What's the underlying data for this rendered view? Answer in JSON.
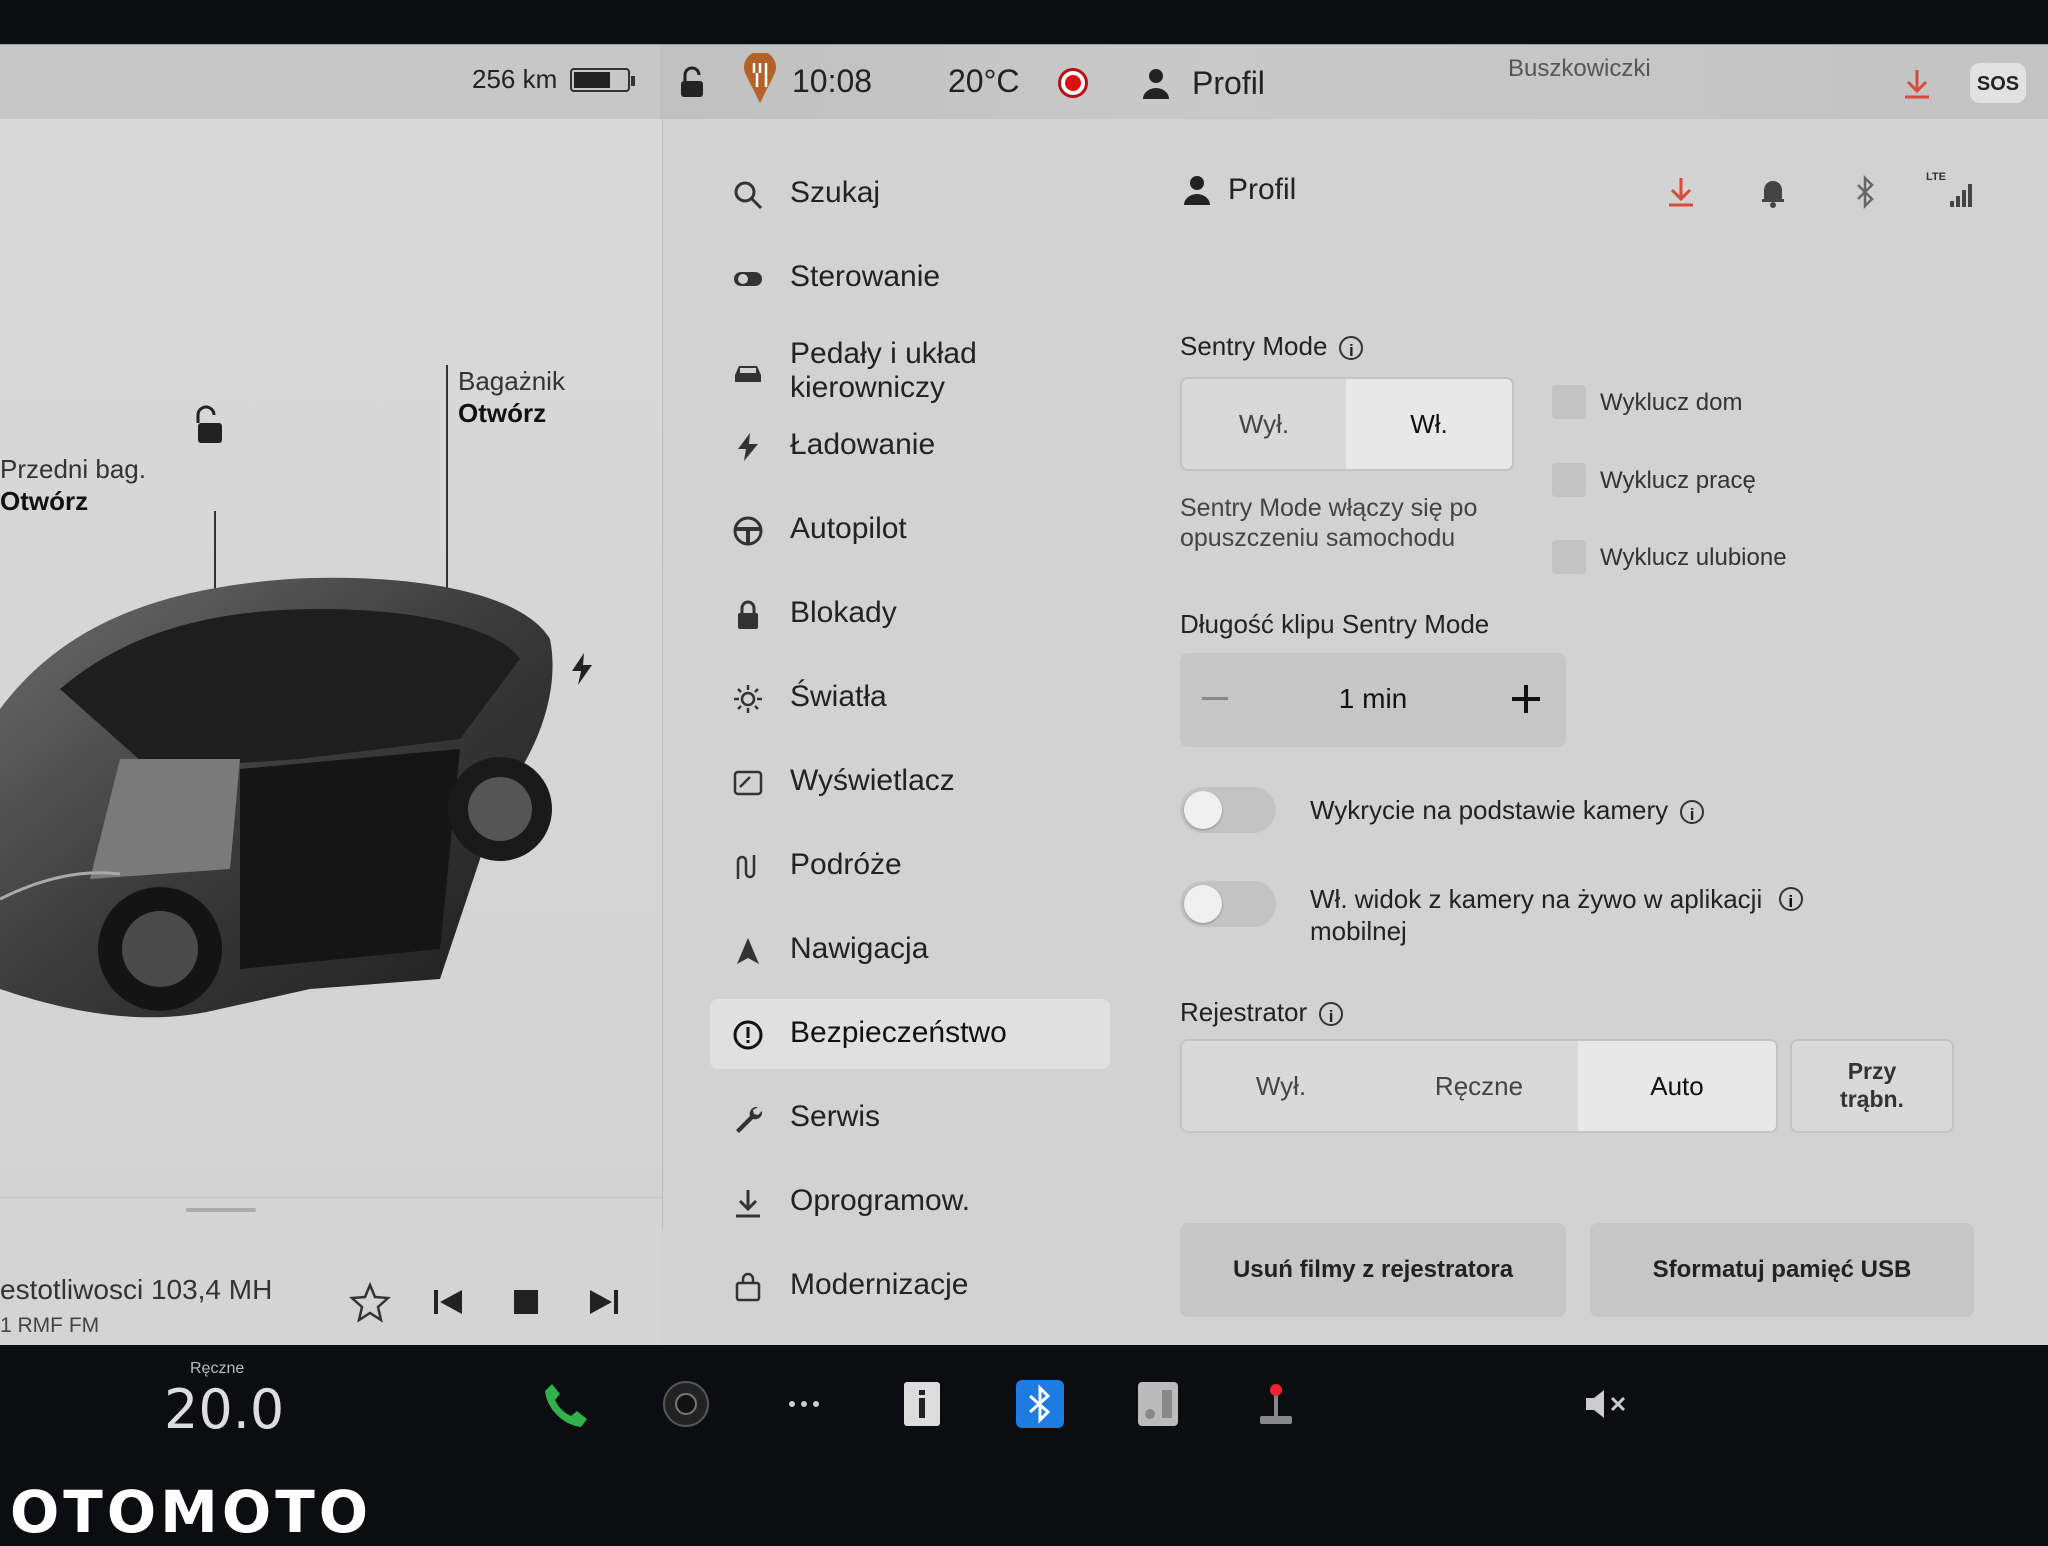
{
  "statusbar": {
    "range": "256 km",
    "battery_level": 0.7,
    "time": "10:08",
    "temperature": "20°C",
    "profile": "Profil",
    "location": "Buszkowiczki",
    "sos": "SOS"
  },
  "car": {
    "front_trunk_label": "Przedni bag.",
    "front_trunk_action": "Otwórz",
    "trunk_label": "Bagażnik",
    "trunk_action": "Otwórz"
  },
  "media": {
    "station": "estotliwosci 103,4 MH",
    "source": "1 RMF FM"
  },
  "menu": {
    "items": [
      {
        "label": "Szukaj",
        "icon": "search-icon"
      },
      {
        "label": "Sterowanie",
        "icon": "toggle-icon"
      },
      {
        "label": "Pedały i układ\nkierowniczy",
        "icon": "car-icon"
      },
      {
        "label": "Ładowanie",
        "icon": "bolt-icon"
      },
      {
        "label": "Autopilot",
        "icon": "steering-wheel-icon"
      },
      {
        "label": "Blokady",
        "icon": "lock-icon"
      },
      {
        "label": "Światła",
        "icon": "sun-icon"
      },
      {
        "label": "Wyświetlacz",
        "icon": "display-icon"
      },
      {
        "label": "Podróże",
        "icon": "route-icon"
      },
      {
        "label": "Nawigacja",
        "icon": "navigation-icon"
      },
      {
        "label": "Bezpieczeństwo",
        "icon": "alert-icon",
        "active": true
      },
      {
        "label": "Serwis",
        "icon": "wrench-icon"
      },
      {
        "label": "Oprogramow.",
        "icon": "download-icon"
      },
      {
        "label": "Modernizacje",
        "icon": "bag-icon"
      }
    ]
  },
  "panel": {
    "header_profile": "Profil",
    "lte": "LTE",
    "sentry": {
      "title": "Sentry Mode",
      "options": [
        "Wył.",
        "Wł."
      ],
      "selected": "Wł.",
      "note": "Sentry Mode włączy się po\nopuszczeniu samochodu",
      "exclusions": [
        "Wyklucz dom",
        "Wyklucz pracę",
        "Wyklucz ulubione"
      ]
    },
    "clip": {
      "title": "Długość klipu Sentry Mode",
      "value": "1 min"
    },
    "camera_detection": {
      "label": "Wykrycie na podstawie kamery",
      "on": false
    },
    "live_view": {
      "label": "Wł. widok z kamery na żywo w aplikacji\nmobilnej",
      "on": false
    },
    "recorder": {
      "title": "Rejestrator",
      "options": [
        "Wył.",
        "Ręczne",
        "Auto"
      ],
      "selected": "Auto",
      "honk_option": "Przy\ntrąbn."
    },
    "buttons": {
      "delete": "Usuń filmy z rejestratora",
      "format": "Sformatuj pamięć USB"
    }
  },
  "bottombar": {
    "climate_mode": "Ręczne",
    "temperature": "20.0"
  },
  "watermark": "OTOMOTO",
  "colors": {
    "accent_red": "#d84a3a",
    "bluetooth_blue": "#1e7be0",
    "phone_green": "#2fb24c"
  }
}
